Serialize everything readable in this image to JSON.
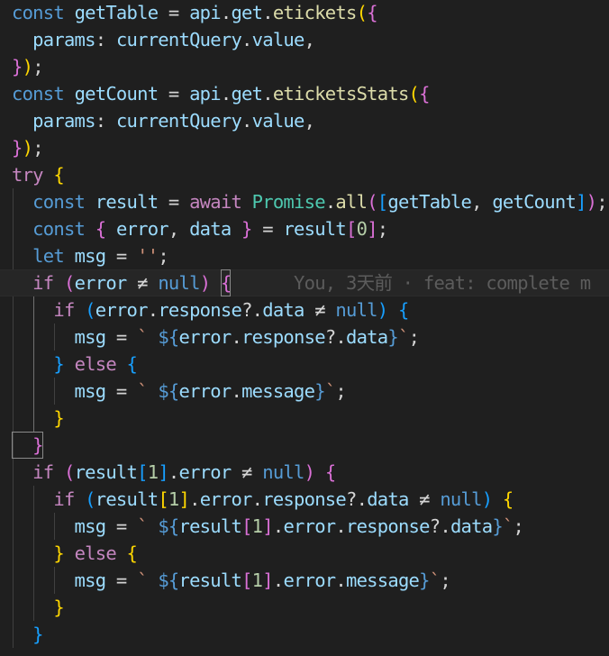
{
  "editor": {
    "theme": {
      "background": "#1f1f1f",
      "keyword": "#569cd6",
      "control": "#c586c0",
      "variable": "#9cdcfe",
      "function": "#dcdcaa",
      "class": "#4ec9b0",
      "string": "#ce9178",
      "number": "#b5cea8",
      "bracket_1": "#ffd700",
      "bracket_2": "#da70d6",
      "bracket_3": "#179fff"
    },
    "gutter_icon": "lightbulb-icon",
    "blame": {
      "line": 11,
      "text": "You, 3天前 · feat: complete m"
    },
    "lines": [
      [
        [
          "const ",
          "kw"
        ],
        [
          "getTable",
          "var"
        ],
        [
          " = ",
          "op"
        ],
        [
          "api",
          "var"
        ],
        [
          ".",
          "op"
        ],
        [
          "get",
          "var"
        ],
        [
          ".",
          "op"
        ],
        [
          "etickets",
          "fn"
        ],
        [
          "(",
          "b1"
        ],
        [
          "{",
          "b2"
        ]
      ],
      [
        [
          "  params",
          "var"
        ],
        [
          ": ",
          "op"
        ],
        [
          "currentQuery",
          "var"
        ],
        [
          ".",
          "op"
        ],
        [
          "value",
          "var"
        ],
        [
          ",",
          "op"
        ]
      ],
      [
        [
          "}",
          "b2"
        ],
        [
          ")",
          "b1"
        ],
        [
          ";",
          "op"
        ]
      ],
      [
        [
          "const ",
          "kw"
        ],
        [
          "getCount",
          "var"
        ],
        [
          " = ",
          "op"
        ],
        [
          "api",
          "var"
        ],
        [
          ".",
          "op"
        ],
        [
          "get",
          "var"
        ],
        [
          ".",
          "op"
        ],
        [
          "eticketsStats",
          "fn"
        ],
        [
          "(",
          "b1"
        ],
        [
          "{",
          "b2"
        ]
      ],
      [
        [
          "  params",
          "var"
        ],
        [
          ": ",
          "op"
        ],
        [
          "currentQuery",
          "var"
        ],
        [
          ".",
          "op"
        ],
        [
          "value",
          "var"
        ],
        [
          ",",
          "op"
        ]
      ],
      [
        [
          "}",
          "b2"
        ],
        [
          ")",
          "b1"
        ],
        [
          ";",
          "op"
        ]
      ],
      [
        [
          "try ",
          "ctl"
        ],
        [
          "{",
          "b1"
        ]
      ],
      [
        [
          "  const ",
          "kw"
        ],
        [
          "result",
          "var"
        ],
        [
          " = ",
          "op"
        ],
        [
          "await ",
          "ctl"
        ],
        [
          "Promise",
          "cls"
        ],
        [
          ".",
          "op"
        ],
        [
          "all",
          "fn"
        ],
        [
          "(",
          "b2"
        ],
        [
          "[",
          "b3"
        ],
        [
          "getTable",
          "var"
        ],
        [
          ", ",
          "op"
        ],
        [
          "getCount",
          "var"
        ],
        [
          "]",
          "b3"
        ],
        [
          ")",
          "b2"
        ],
        [
          ";",
          "op"
        ]
      ],
      [
        [
          "  const ",
          "kw"
        ],
        [
          "{ ",
          "b2"
        ],
        [
          "error",
          "var"
        ],
        [
          ", ",
          "op"
        ],
        [
          "data",
          "var"
        ],
        [
          " }",
          "b2"
        ],
        [
          " = ",
          "op"
        ],
        [
          "result",
          "var"
        ],
        [
          "[",
          "b2"
        ],
        [
          "0",
          "num"
        ],
        [
          "]",
          "b2"
        ],
        [
          ";",
          "op"
        ]
      ],
      [
        [
          "  let ",
          "kw"
        ],
        [
          "msg",
          "var"
        ],
        [
          " = ",
          "op"
        ],
        [
          "''",
          "str"
        ],
        [
          ";",
          "op"
        ]
      ],
      [
        [
          "  if ",
          "ctl"
        ],
        [
          "(",
          "b2"
        ],
        [
          "error",
          "var"
        ],
        [
          " ≠ ",
          "op"
        ],
        [
          "null",
          "kw"
        ],
        [
          ")",
          "b2"
        ],
        [
          " ",
          "op"
        ],
        [
          "{",
          "b2",
          "cursor"
        ],
        [
          "      ",
          "op"
        ]
      ],
      [
        [
          "    if ",
          "ctl"
        ],
        [
          "(",
          "b3"
        ],
        [
          "error",
          "var"
        ],
        [
          ".",
          "op"
        ],
        [
          "response",
          "var"
        ],
        [
          "?.",
          "op"
        ],
        [
          "data",
          "var"
        ],
        [
          " ≠ ",
          "op"
        ],
        [
          "null",
          "kw"
        ],
        [
          ")",
          "b3"
        ],
        [
          " ",
          "op"
        ],
        [
          "{",
          "b3"
        ]
      ],
      [
        [
          "      msg",
          "var"
        ],
        [
          " = ",
          "op"
        ],
        [
          "` ",
          "str"
        ],
        [
          "${",
          "tpl"
        ],
        [
          "error",
          "var"
        ],
        [
          ".",
          "op"
        ],
        [
          "response",
          "var"
        ],
        [
          "?.",
          "op"
        ],
        [
          "data",
          "var"
        ],
        [
          "}",
          "tpl"
        ],
        [
          "`",
          "str"
        ],
        [
          ";",
          "op"
        ]
      ],
      [
        [
          "    } ",
          "b3"
        ],
        [
          "else ",
          "ctl"
        ],
        [
          "{",
          "b3"
        ]
      ],
      [
        [
          "      msg",
          "var"
        ],
        [
          " = ",
          "op"
        ],
        [
          "` ",
          "str"
        ],
        [
          "${",
          "tpl"
        ],
        [
          "error",
          "var"
        ],
        [
          ".",
          "op"
        ],
        [
          "message",
          "var"
        ],
        [
          "}",
          "tpl"
        ],
        [
          "`",
          "str"
        ],
        [
          ";",
          "op"
        ]
      ],
      [
        [
          "    }",
          "b1"
        ]
      ],
      [
        [
          "  }",
          "b2",
          "cursor"
        ]
      ],
      [
        [
          "  if ",
          "ctl"
        ],
        [
          "(",
          "b2"
        ],
        [
          "result",
          "var"
        ],
        [
          "[",
          "b3"
        ],
        [
          "1",
          "num"
        ],
        [
          "]",
          "b3"
        ],
        [
          ".",
          "op"
        ],
        [
          "error",
          "var"
        ],
        [
          " ≠ ",
          "op"
        ],
        [
          "null",
          "kw"
        ],
        [
          ")",
          "b2"
        ],
        [
          " ",
          "op"
        ],
        [
          "{",
          "b2"
        ]
      ],
      [
        [
          "    if ",
          "ctl"
        ],
        [
          "(",
          "b3"
        ],
        [
          "result",
          "var"
        ],
        [
          "[",
          "b1"
        ],
        [
          "1",
          "num"
        ],
        [
          "]",
          "b1"
        ],
        [
          ".",
          "op"
        ],
        [
          "error",
          "var"
        ],
        [
          ".",
          "op"
        ],
        [
          "response",
          "var"
        ],
        [
          "?.",
          "op"
        ],
        [
          "data",
          "var"
        ],
        [
          " ≠ ",
          "op"
        ],
        [
          "null",
          "kw"
        ],
        [
          ")",
          "b3"
        ],
        [
          " ",
          "op"
        ],
        [
          "{",
          "b1"
        ]
      ],
      [
        [
          "      msg",
          "var"
        ],
        [
          " = ",
          "op"
        ],
        [
          "` ",
          "str"
        ],
        [
          "${",
          "tpl"
        ],
        [
          "result",
          "var"
        ],
        [
          "[",
          "b2"
        ],
        [
          "1",
          "num"
        ],
        [
          "]",
          "b2"
        ],
        [
          ".",
          "op"
        ],
        [
          "error",
          "var"
        ],
        [
          ".",
          "op"
        ],
        [
          "response",
          "var"
        ],
        [
          "?.",
          "op"
        ],
        [
          "data",
          "var"
        ],
        [
          "}",
          "tpl"
        ],
        [
          "`",
          "str"
        ],
        [
          ";",
          "op"
        ]
      ],
      [
        [
          "    } ",
          "b1"
        ],
        [
          "else ",
          "ctl"
        ],
        [
          "{",
          "b1"
        ]
      ],
      [
        [
          "      msg",
          "var"
        ],
        [
          " = ",
          "op"
        ],
        [
          "` ",
          "str"
        ],
        [
          "${",
          "tpl"
        ],
        [
          "result",
          "var"
        ],
        [
          "[",
          "b2"
        ],
        [
          "1",
          "num"
        ],
        [
          "]",
          "b2"
        ],
        [
          ".",
          "op"
        ],
        [
          "error",
          "var"
        ],
        [
          ".",
          "op"
        ],
        [
          "message",
          "var"
        ],
        [
          "}",
          "tpl"
        ],
        [
          "`",
          "str"
        ],
        [
          ";",
          "op"
        ]
      ],
      [
        [
          "    }",
          "b1"
        ]
      ],
      [
        [
          "  }",
          "b3"
        ]
      ]
    ]
  }
}
